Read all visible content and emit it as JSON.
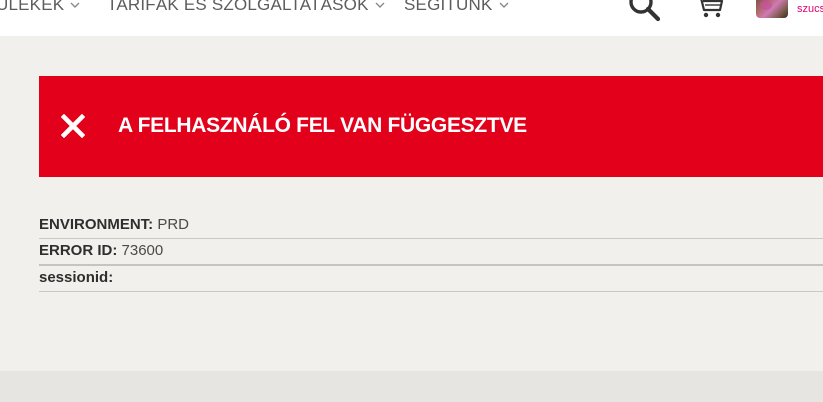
{
  "nav": {
    "items": [
      {
        "label": "ÜLEKEK"
      },
      {
        "label": "TARIFÁK ÉS SZOLGÁLTATÁSOK"
      },
      {
        "label": "SEGÍTÜNK"
      }
    ]
  },
  "toolbar": {
    "search_icon": "search-icon",
    "cart_icon": "cart-icon",
    "username": "szucs"
  },
  "error": {
    "icon": "close-icon",
    "title": "A FELHASZNÁLÓ FEL VAN FÜGGESZTVE"
  },
  "details": [
    {
      "label": "ENVIRONMENT:",
      "value": "PRD"
    },
    {
      "label": "ERROR ID:",
      "value": "73600"
    },
    {
      "label": "sessionid:",
      "value": ""
    }
  ],
  "colors": {
    "error_red": "#e2001a",
    "brand_magenta": "#e20074",
    "background": "#f1f0ec"
  }
}
